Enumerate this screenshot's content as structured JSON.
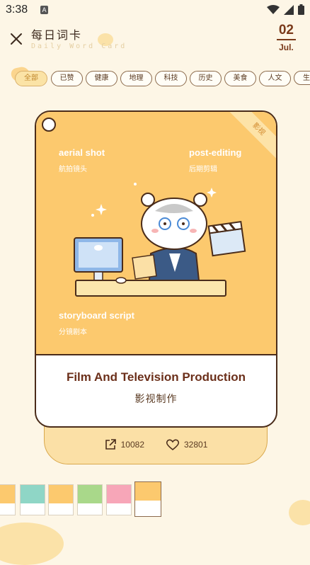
{
  "status_bar": {
    "time": "3:38",
    "app_indicator": "A"
  },
  "header": {
    "title": "每日词卡",
    "subtitle": "Daily Word Card",
    "date_day": "02",
    "date_month": "Jul."
  },
  "tabs": [
    {
      "label": "全部",
      "active": true
    },
    {
      "label": "已赞",
      "active": false
    },
    {
      "label": "健康",
      "active": false
    },
    {
      "label": "地理",
      "active": false
    },
    {
      "label": "科技",
      "active": false
    },
    {
      "label": "历史",
      "active": false
    },
    {
      "label": "美食",
      "active": false
    },
    {
      "label": "人文",
      "active": false
    },
    {
      "label": "生",
      "active": false
    }
  ],
  "card": {
    "ribbon": "影视",
    "words": [
      {
        "en": "aerial shot",
        "zh": "航拍镜头"
      },
      {
        "en": "post-editing",
        "zh": "后期剪辑"
      },
      {
        "en": "storyboard script",
        "zh": "分镜剧本"
      }
    ],
    "title_en": "Film And Television Production",
    "title_zh": "影视制作",
    "top_color": "#fcc96e"
  },
  "stats": {
    "shares": "10082",
    "likes": "32801"
  },
  "thumbnails": [
    {
      "color": "#fcc96e"
    },
    {
      "color": "#8fd6c6"
    },
    {
      "color": "#fcc96e"
    },
    {
      "color": "#a9d88a"
    },
    {
      "color": "#f7a6b8"
    },
    {
      "color": "#fcc96e",
      "active": true
    }
  ],
  "colors": {
    "accent": "#fcc96e",
    "background": "#fdf6e6",
    "brown": "#6b2f1a"
  }
}
